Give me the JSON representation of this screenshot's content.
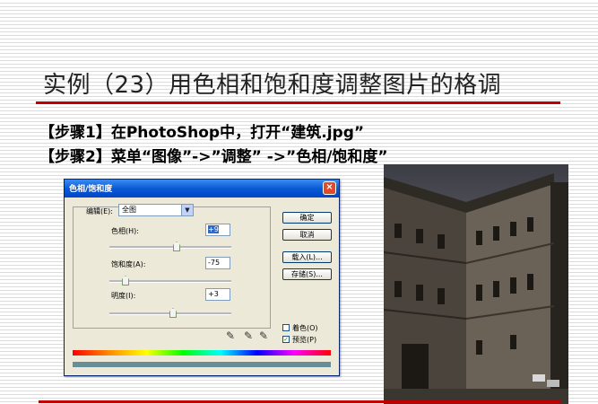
{
  "slide": {
    "title": "实例（23）用色相和饱和度调整图片的格调",
    "step1": "【步骤1】在PhotoShop中，打开“建筑.jpg”",
    "step2": "【步骤2】菜单“图像”->”调整” ->”色相/饱和度”"
  },
  "dialog": {
    "title": "色相/饱和度",
    "close": "×",
    "edit_label": "编辑(E):",
    "edit_value": "全图",
    "hue_label": "色相(H):",
    "hue_value": "+9",
    "saturation_label": "饱和度(A):",
    "saturation_value": "-75",
    "lightness_label": "明度(I):",
    "lightness_value": "+3",
    "ok": "确定",
    "cancel": "取消",
    "load": "载入(L)...",
    "save": "存储(S)...",
    "colorize_label": "着色(O)",
    "colorize_checked": false,
    "preview_label": "预览(P)",
    "preview_checked": true,
    "hue_slider": 9,
    "saturation_slider": -75,
    "lightness_slider": 3
  },
  "photo": {
    "subject": "building-photo"
  }
}
